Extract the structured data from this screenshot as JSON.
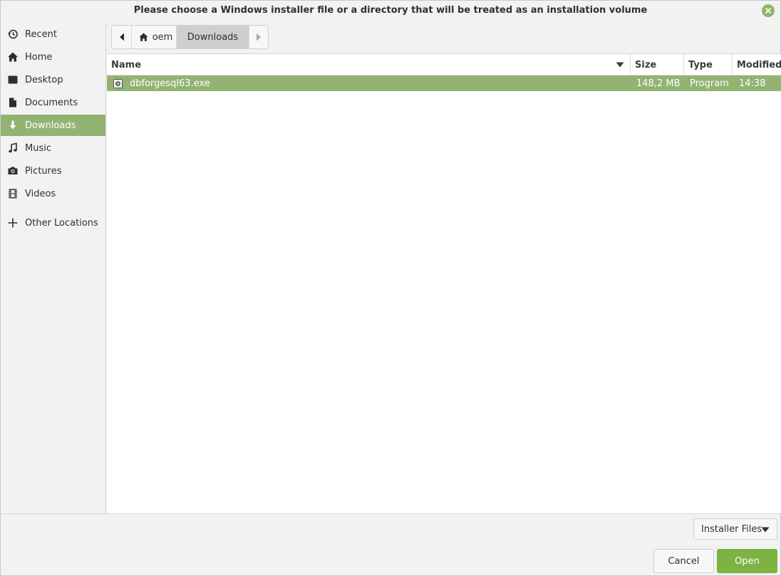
{
  "dialog": {
    "title": "Please choose a Windows installer file or a directory that will be treated as an installation volume"
  },
  "sidebar": {
    "items": [
      {
        "label": "Recent",
        "icon": "recent-icon"
      },
      {
        "label": "Home",
        "icon": "home-icon"
      },
      {
        "label": "Desktop",
        "icon": "desktop-icon"
      },
      {
        "label": "Documents",
        "icon": "document-icon"
      },
      {
        "label": "Downloads",
        "icon": "download-icon",
        "active": true
      },
      {
        "label": "Music",
        "icon": "music-icon"
      },
      {
        "label": "Pictures",
        "icon": "camera-icon"
      },
      {
        "label": "Videos",
        "icon": "film-icon"
      },
      {
        "label": "Other Locations",
        "icon": "plus-icon"
      }
    ]
  },
  "pathbar": {
    "home_label": "oem",
    "current_label": "Downloads"
  },
  "columns": {
    "name": "Name",
    "size": "Size",
    "type": "Type",
    "modified": "Modified"
  },
  "files": [
    {
      "name": "dbforgesql63.exe",
      "size": "148,2 MB",
      "type": "Program",
      "modified": "14:38",
      "selected": true,
      "icon": "executable-icon"
    }
  ],
  "footer": {
    "filter_label": "Installer Files",
    "cancel_label": "Cancel",
    "open_label": "Open"
  },
  "colors": {
    "accent": "#92b372",
    "open_button": "#7cb342"
  }
}
